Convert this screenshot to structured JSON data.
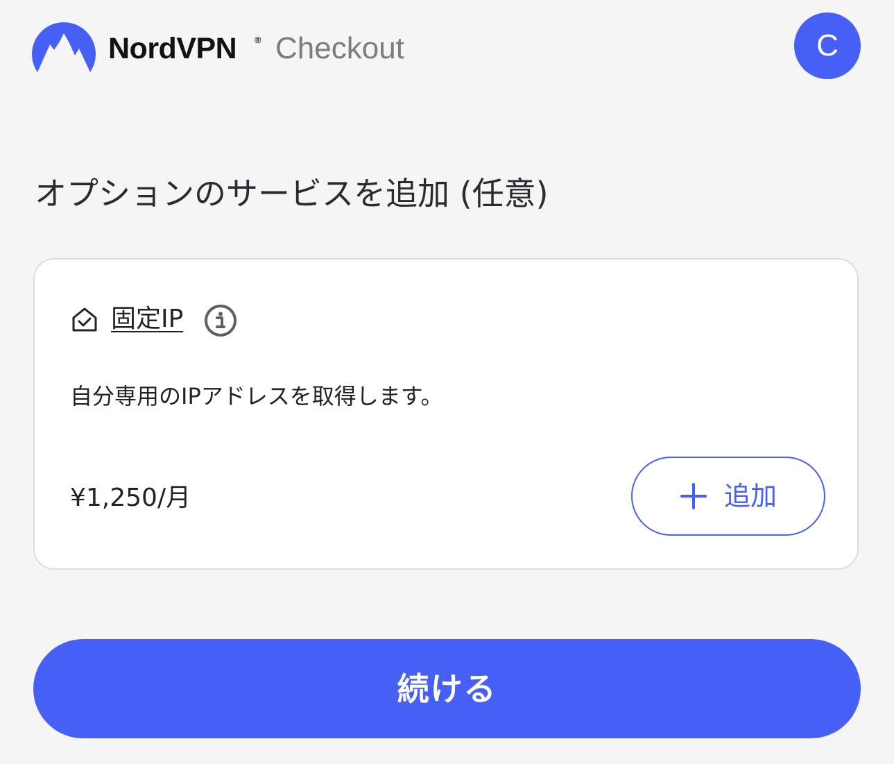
{
  "header": {
    "brand": "NordVPN",
    "brand_registered": "®",
    "section": "Checkout",
    "avatar_initial": "C",
    "logo_icon": "nordvpn-mountain-logo"
  },
  "page": {
    "title": "オプションのサービスを追加 (任意)"
  },
  "addon": {
    "icon": "home-check-icon",
    "name": "固定IP",
    "info_icon": "info-icon",
    "description": "自分専用のIPアドレスを取得します。",
    "price": "¥1,250/月",
    "add_button": {
      "icon": "plus-icon",
      "label": "追加"
    }
  },
  "footer": {
    "continue_label": "続ける"
  },
  "colors": {
    "accent": "#4660f5",
    "background": "#f5f5f6",
    "card_border": "#dcdde0",
    "text_primary": "#222326",
    "text_muted": "#7b7c80"
  }
}
